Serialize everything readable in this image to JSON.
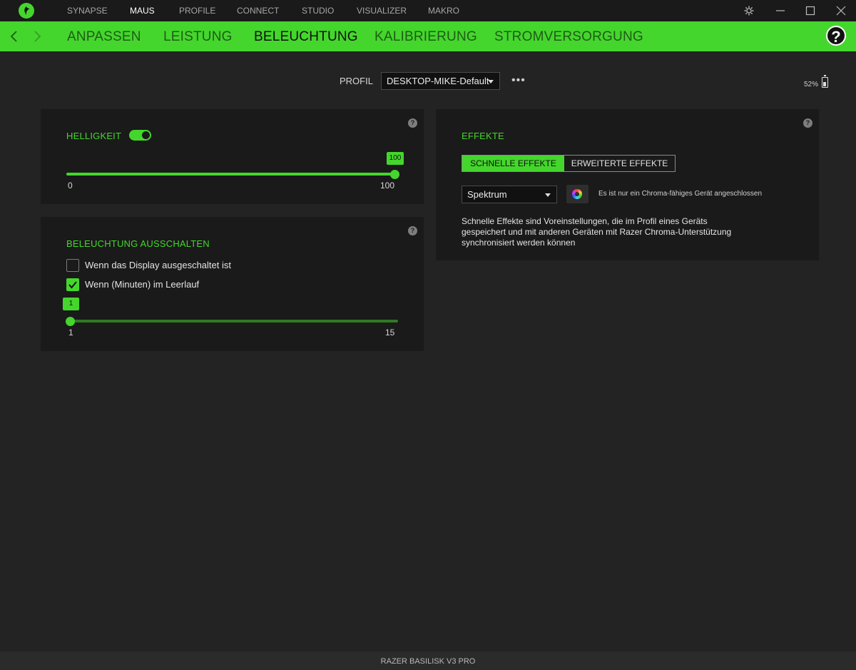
{
  "topnav": {
    "items": [
      {
        "label": "SYNAPSE"
      },
      {
        "label": "MAUS"
      },
      {
        "label": "PROFILE"
      },
      {
        "label": "CONNECT"
      },
      {
        "label": "STUDIO"
      },
      {
        "label": "VISUALIZER"
      },
      {
        "label": "MAKRO"
      }
    ],
    "active": "MAUS"
  },
  "subnav": {
    "items": [
      {
        "label": "ANPASSEN"
      },
      {
        "label": "LEISTUNG"
      },
      {
        "label": "BELEUCHTUNG"
      },
      {
        "label": "KALIBRIERUNG"
      },
      {
        "label": "STROMVERSORGUNG"
      }
    ],
    "active": "BELEUCHTUNG",
    "help": "?"
  },
  "profile": {
    "label": "PROFIL",
    "selected": "DESKTOP-MIKE-Default",
    "more": "•••"
  },
  "battery": {
    "text": "52%",
    "percent": 52
  },
  "brightness": {
    "title": "HELLIGKEIT",
    "enabled": true,
    "value": "100",
    "min": "0",
    "max": "100",
    "help": "?"
  },
  "lights_off": {
    "title": "BELEUCHTUNG AUSSCHALTEN",
    "help": "?",
    "option_display": {
      "label": "Wenn das Display ausgeschaltet ist",
      "checked": false
    },
    "option_idle": {
      "label": "Wenn (Minuten) im Leerlauf",
      "checked": true
    },
    "slider": {
      "value": "1",
      "min": "1",
      "max": "15"
    }
  },
  "effects": {
    "title": "EFFEKTE",
    "help": "?",
    "tab_quick": "SCHNELLE EFFEKTE",
    "tab_advanced": "ERWEITERTE EFFEKTE",
    "active_tab": "SCHNELLE EFFEKTE",
    "selected_effect": "Spektrum",
    "chroma_note": "Es ist nur ein Chroma-fähiges Gerät angeschlossen",
    "description_lines": [
      "Schnelle Effekte sind Voreinstellungen, die im Profil eines Geräts",
      "gespeichert und mit anderen Geräten mit Razer Chroma-Unterstützung",
      "synchronisiert werden können"
    ]
  },
  "device": {
    "name": "RAZER BASILISK V3 PRO"
  },
  "colors": {
    "accent": "#44d62c",
    "panel": "#1a1a1a",
    "background": "#232323"
  }
}
